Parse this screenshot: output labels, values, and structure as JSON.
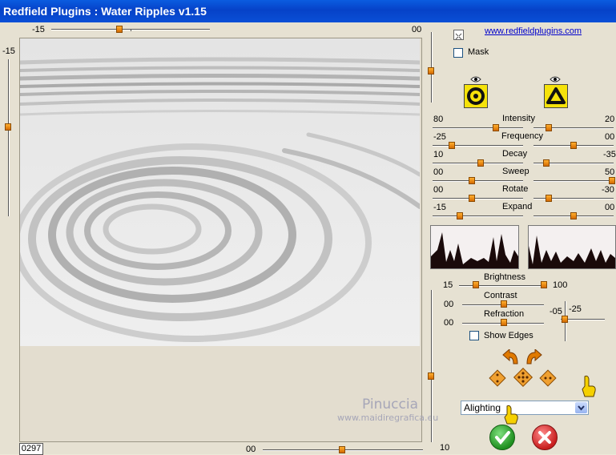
{
  "window": {
    "title": "Redfield Plugins : Water Ripples v1.15"
  },
  "top_slider": {
    "min_label": "-15",
    "max_label": "00"
  },
  "left_slider": {
    "label": "-15"
  },
  "right_v_slider": {
    "bottom_label": "10"
  },
  "bottom_slider": {
    "label": "00"
  },
  "counter": "0297",
  "link": "www.redfieldplugins.com",
  "mask_label": "Mask",
  "params": [
    {
      "name": "Intensity",
      "left": "80",
      "right": "20"
    },
    {
      "name": "Frequency",
      "left": "-25",
      "right": "00"
    },
    {
      "name": "Decay",
      "left": "10",
      "right": "-35"
    },
    {
      "name": "Sweep",
      "left": "00",
      "right": "50"
    },
    {
      "name": "Rotate",
      "left": "00",
      "right": "-30"
    },
    {
      "name": "Expand",
      "left": "-15",
      "right": "00"
    }
  ],
  "brightness": {
    "label": "Brightness",
    "min": "15",
    "max": "100"
  },
  "contrast": {
    "label": "Contrast",
    "value": "00"
  },
  "refraction": {
    "label": "Refraction",
    "value": "00"
  },
  "light_angle": {
    "left": "-05",
    "right": "-25"
  },
  "show_edges_label": "Show Edges",
  "lighting_select": {
    "value": "Alighting"
  },
  "watermark": {
    "name": "Pinuccia",
    "site": "www.maidiregrafica.eu"
  },
  "colors": {
    "title_bar": "#0a4fd6",
    "ok": "#2aa52a",
    "cancel": "#d62a2a",
    "thumb": "#e07a00"
  }
}
